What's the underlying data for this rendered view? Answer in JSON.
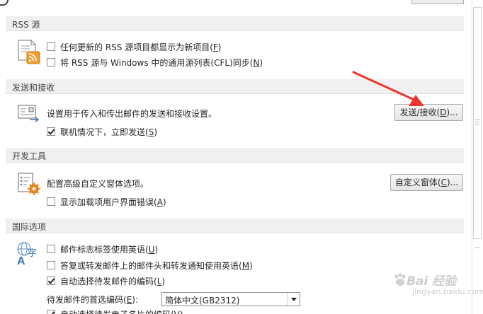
{
  "sections": {
    "rss": {
      "header": "RSS 源",
      "options": [
        {
          "pre": "任何更新的 RSS 源项目都显示为新项目(",
          "key": "F",
          "post": ")",
          "checked": false
        },
        {
          "pre": "将 RSS 源与 Windows 中的通用源列表(CFL)同步(",
          "key": "N",
          "post": ")",
          "checked": false
        }
      ]
    },
    "send_receive": {
      "header": "发送和接收",
      "description": "设置用于传入和传出邮件的发送和接收设置。",
      "button": {
        "pre": "发送/接收(",
        "key": "D",
        "post": ")..."
      },
      "options": [
        {
          "pre": "联机情况下，立即发送(",
          "key": "S",
          "post": ")",
          "checked": true
        }
      ]
    },
    "developer": {
      "header": "开发工具",
      "description": "配置高级自定义窗体选项。",
      "button": {
        "pre": "自定义窗体(",
        "key": "C",
        "post": ")..."
      },
      "options": [
        {
          "pre": "显示加载项用户界面错误(",
          "key": "A",
          "post": ")",
          "checked": false
        }
      ]
    },
    "international": {
      "header": "国际选项",
      "options": [
        {
          "pre": "邮件标志标签使用英语(",
          "key": "U",
          "post": ")",
          "checked": false
        },
        {
          "pre": "答复或转发邮件上的邮件头和转发通知使用英语(",
          "key": "M",
          "post": ")",
          "checked": false
        },
        {
          "pre": "自动选择待发邮件的编码(",
          "key": "L",
          "post": ")",
          "checked": true
        }
      ],
      "encoding_label": {
        "pre": "待发邮件的首选编码(",
        "key": "E",
        "post": "):"
      },
      "encoding_value": "简体中文(GB2312)",
      "partial_option": "自动选择待发电子名片的编码(V)"
    }
  },
  "watermark": {
    "brand": "Bai 经验",
    "url": "jingyan.baidu.com"
  },
  "colors": {
    "annotation_arrow": "#e8362e",
    "section_header_bg": "#f0f0f0",
    "rss_icon": "#f0a030"
  }
}
